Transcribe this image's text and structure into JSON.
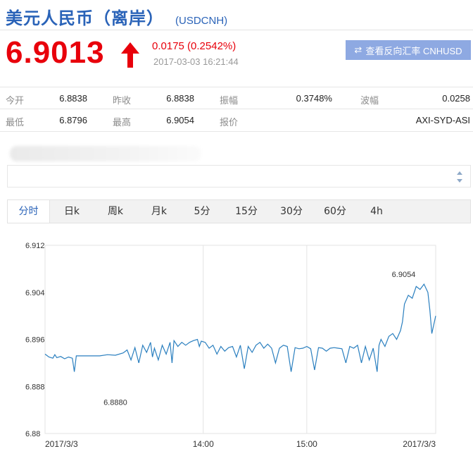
{
  "header": {
    "title": "美元人民币（离岸）",
    "symbol": "(USDCNH)"
  },
  "quote": {
    "price": "6.9013",
    "direction": "up",
    "change": "0.0175 (0.2542%)",
    "timestamp": "2017-03-03 16:21:44",
    "color_up": "#e8000b"
  },
  "reverse_button": {
    "icon": "swap-arrows-icon",
    "label": "查看反向汇率 CNHUSD"
  },
  "stats": {
    "open_label": "今开",
    "open_value": "6.8838",
    "prev_close_label": "昨收",
    "prev_close_value": "6.8838",
    "amplitude_label": "振幅",
    "amplitude_value": "0.3748%",
    "wave_label": "波幅",
    "wave_value": "0.0258",
    "low_label": "最低",
    "low_value": "6.8796",
    "high_label": "最高",
    "high_value": "6.9054",
    "quote_label": "报价",
    "quote_value": "AXI-SYD-ASI"
  },
  "tabs": [
    {
      "label": "分时",
      "active": true
    },
    {
      "label": "日k",
      "active": false
    },
    {
      "label": "周k",
      "active": false
    },
    {
      "label": "月k",
      "active": false
    },
    {
      "label": "5分",
      "active": false
    },
    {
      "label": "15分",
      "active": false
    },
    {
      "label": "30分",
      "active": false
    },
    {
      "label": "60分",
      "active": false
    },
    {
      "label": "4h",
      "active": false
    }
  ],
  "chart_data": {
    "type": "line",
    "title": "",
    "xlabel": "",
    "ylabel": "",
    "ylim": [
      6.88,
      6.912
    ],
    "yticks": [
      "6.912",
      "6.904",
      "6.896",
      "6.888",
      "6.88"
    ],
    "xticks": [
      {
        "label": "2017/3/3",
        "at": 0.0
      },
      {
        "label": "14:00",
        "at": 0.405
      },
      {
        "label": "15:00",
        "at": 0.67
      },
      {
        "label": "2017/3/3",
        "at": 1.0
      }
    ],
    "annotations": [
      {
        "text": "6.8880",
        "x": 0.18,
        "y": 6.888
      },
      {
        "text": "6.9054",
        "x": 0.918,
        "y": 6.9054
      }
    ],
    "grid": true,
    "line_color": "#2a7fbf",
    "series": [
      {
        "x": [
          0.0,
          0.01,
          0.02,
          0.025,
          0.03,
          0.04,
          0.05,
          0.06,
          0.07,
          0.075,
          0.08,
          0.09,
          0.1,
          0.12,
          0.14,
          0.16,
          0.18,
          0.2,
          0.21,
          0.22,
          0.23,
          0.24,
          0.25,
          0.26,
          0.27,
          0.275,
          0.28,
          0.29,
          0.3,
          0.31,
          0.32,
          0.325,
          0.33,
          0.34,
          0.35,
          0.36,
          0.37,
          0.38,
          0.39,
          0.395,
          0.4,
          0.41,
          0.42,
          0.43,
          0.44,
          0.45,
          0.46,
          0.47,
          0.48,
          0.49,
          0.5,
          0.51,
          0.52,
          0.53,
          0.54,
          0.55,
          0.56,
          0.57,
          0.58,
          0.59,
          0.6,
          0.61,
          0.62,
          0.63,
          0.64,
          0.65,
          0.66,
          0.67,
          0.68,
          0.69,
          0.7,
          0.71,
          0.72,
          0.73,
          0.74,
          0.75,
          0.76,
          0.77,
          0.78,
          0.79,
          0.8,
          0.81,
          0.82,
          0.83,
          0.84,
          0.85,
          0.855,
          0.86,
          0.87,
          0.88,
          0.89,
          0.9,
          0.91,
          0.915,
          0.92,
          0.93,
          0.94,
          0.95,
          0.96,
          0.97,
          0.98,
          0.985,
          0.99,
          1.0
        ],
        "values": [
          6.8935,
          6.893,
          6.8928,
          6.8934,
          6.8929,
          6.8931,
          6.8927,
          6.893,
          6.8928,
          6.8905,
          6.8932,
          6.8932,
          6.8932,
          6.8932,
          6.8932,
          6.8934,
          6.8933,
          6.8937,
          6.8942,
          6.8925,
          6.8946,
          6.892,
          6.895,
          6.8938,
          6.8955,
          6.893,
          6.8945,
          6.8925,
          6.895,
          6.8935,
          6.8955,
          6.892,
          6.8958,
          6.8948,
          6.8955,
          6.895,
          6.8955,
          6.8958,
          6.896,
          6.8948,
          6.8957,
          6.8955,
          6.8945,
          6.895,
          6.8935,
          6.8948,
          6.894,
          6.8946,
          6.8948,
          6.893,
          6.895,
          6.891,
          6.8948,
          6.8938,
          6.895,
          6.8955,
          6.8945,
          6.8952,
          6.8945,
          6.892,
          6.8945,
          6.895,
          6.8948,
          6.8905,
          6.8946,
          6.8944,
          6.8945,
          6.8948,
          6.8944,
          6.8908,
          6.8946,
          6.8945,
          6.894,
          6.8945,
          6.8946,
          6.8945,
          6.8944,
          6.892,
          6.8948,
          6.8945,
          6.895,
          6.892,
          6.8948,
          6.8925,
          6.8945,
          6.8905,
          6.895,
          6.896,
          6.8948,
          6.8965,
          6.897,
          6.896,
          6.8975,
          6.899,
          6.902,
          6.9035,
          6.903,
          6.905,
          6.9045,
          6.9054,
          6.904,
          6.901,
          6.897,
          6.9
        ]
      }
    ]
  }
}
